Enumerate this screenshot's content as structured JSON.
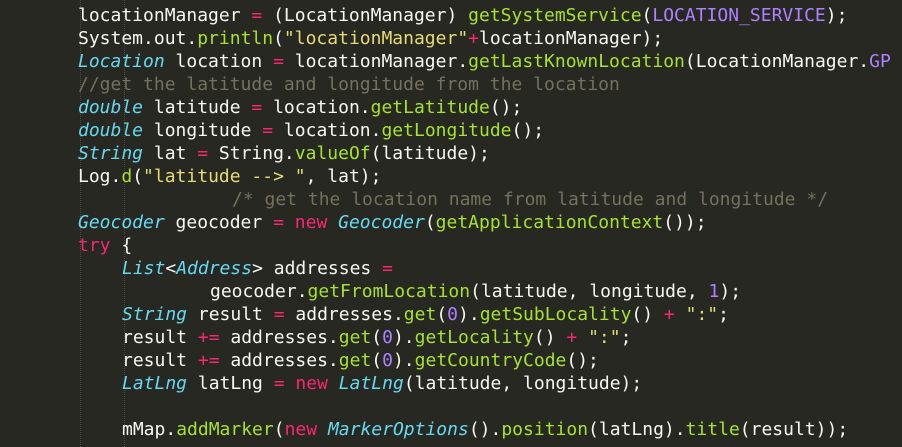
{
  "editor": {
    "language": "java",
    "theme": "monokai",
    "colors": {
      "background": "#272822",
      "plain": "#f8f8f2",
      "method": "#a6e22e",
      "type": "#66d9ef",
      "keyword": "#f92672",
      "string": "#e6db74",
      "number": "#ae81ff",
      "comment": "#75715e"
    },
    "lines": [
      {
        "indent": 1,
        "tokens": [
          {
            "t": "tk",
            "v": "locationManager "
          },
          {
            "t": "op",
            "v": "="
          },
          {
            "t": "tk",
            "v": " (LocationManager) "
          },
          {
            "t": "fn",
            "v": "getSystemService"
          },
          {
            "t": "tk",
            "v": "("
          },
          {
            "t": "cst",
            "v": "LOCATION_SERVICE"
          },
          {
            "t": "tk",
            "v": ");"
          }
        ]
      },
      {
        "indent": 1,
        "tokens": [
          {
            "t": "tk",
            "v": "System.out."
          },
          {
            "t": "fn",
            "v": "println"
          },
          {
            "t": "tk",
            "v": "("
          },
          {
            "t": "str",
            "v": "\"locationManager\""
          },
          {
            "t": "op",
            "v": "+"
          },
          {
            "t": "tk",
            "v": "locationManager);"
          }
        ]
      },
      {
        "indent": 1,
        "tokens": [
          {
            "t": "ty",
            "v": "Location"
          },
          {
            "t": "tk",
            "v": " location "
          },
          {
            "t": "op",
            "v": "="
          },
          {
            "t": "tk",
            "v": " locationManager."
          },
          {
            "t": "fn",
            "v": "getLastKnownLocation"
          },
          {
            "t": "tk",
            "v": "(LocationManager."
          },
          {
            "t": "cst",
            "v": "GP"
          }
        ]
      },
      {
        "indent": 1,
        "tokens": [
          {
            "t": "cm",
            "v": "//get the latitude and longitude from the location"
          }
        ]
      },
      {
        "indent": 1,
        "tokens": [
          {
            "t": "ty",
            "v": "double"
          },
          {
            "t": "tk",
            "v": " latitude "
          },
          {
            "t": "op",
            "v": "="
          },
          {
            "t": "tk",
            "v": " location."
          },
          {
            "t": "fn",
            "v": "getLatitude"
          },
          {
            "t": "tk",
            "v": "();"
          }
        ]
      },
      {
        "indent": 1,
        "tokens": [
          {
            "t": "ty",
            "v": "double"
          },
          {
            "t": "tk",
            "v": " longitude "
          },
          {
            "t": "op",
            "v": "="
          },
          {
            "t": "tk",
            "v": " location."
          },
          {
            "t": "fn",
            "v": "getLongitude"
          },
          {
            "t": "tk",
            "v": "();"
          }
        ]
      },
      {
        "indent": 1,
        "tokens": [
          {
            "t": "ty",
            "v": "String"
          },
          {
            "t": "tk",
            "v": " lat "
          },
          {
            "t": "op",
            "v": "="
          },
          {
            "t": "tk",
            "v": " String."
          },
          {
            "t": "fn",
            "v": "valueOf"
          },
          {
            "t": "tk",
            "v": "(latitude);"
          }
        ]
      },
      {
        "indent": 1,
        "tokens": [
          {
            "t": "tk",
            "v": "Log."
          },
          {
            "t": "fn",
            "v": "d"
          },
          {
            "t": "tk",
            "v": "("
          },
          {
            "t": "str",
            "v": "\"latitude --> \""
          },
          {
            "t": "tk",
            "v": ", lat);"
          }
        ]
      },
      {
        "indent": "c",
        "tokens": [
          {
            "t": "cm",
            "v": "/* get the location name from latitude and longitude */"
          }
        ]
      },
      {
        "indent": 1,
        "tokens": [
          {
            "t": "ty",
            "v": "Geocoder"
          },
          {
            "t": "tk",
            "v": " geocoder "
          },
          {
            "t": "op",
            "v": "="
          },
          {
            "t": "tk",
            "v": " "
          },
          {
            "t": "kw",
            "v": "new"
          },
          {
            "t": "tk",
            "v": " "
          },
          {
            "t": "ty",
            "v": "Geocoder"
          },
          {
            "t": "tk",
            "v": "("
          },
          {
            "t": "fn",
            "v": "getApplicationContext"
          },
          {
            "t": "tk",
            "v": "());"
          }
        ]
      },
      {
        "indent": 1,
        "tokens": [
          {
            "t": "kw",
            "v": "try"
          },
          {
            "t": "tk",
            "v": " {"
          }
        ]
      },
      {
        "indent": 2,
        "tokens": [
          {
            "t": "ty",
            "v": "List"
          },
          {
            "t": "tk",
            "v": "<"
          },
          {
            "t": "ty",
            "v": "Address"
          },
          {
            "t": "tk",
            "v": "> addresses "
          },
          {
            "t": "op",
            "v": "="
          }
        ]
      },
      {
        "indent": 3,
        "tokens": [
          {
            "t": "tk",
            "v": "geocoder."
          },
          {
            "t": "fn",
            "v": "getFromLocation"
          },
          {
            "t": "tk",
            "v": "(latitude, longitude, "
          },
          {
            "t": "num",
            "v": "1"
          },
          {
            "t": "tk",
            "v": ");"
          }
        ]
      },
      {
        "indent": 2,
        "tokens": [
          {
            "t": "ty",
            "v": "String"
          },
          {
            "t": "tk",
            "v": " result "
          },
          {
            "t": "op",
            "v": "="
          },
          {
            "t": "tk",
            "v": " addresses."
          },
          {
            "t": "fn",
            "v": "get"
          },
          {
            "t": "tk",
            "v": "("
          },
          {
            "t": "num",
            "v": "0"
          },
          {
            "t": "tk",
            "v": ")."
          },
          {
            "t": "fn",
            "v": "getSubLocality"
          },
          {
            "t": "tk",
            "v": "() "
          },
          {
            "t": "op",
            "v": "+"
          },
          {
            "t": "tk",
            "v": " "
          },
          {
            "t": "str",
            "v": "\":\""
          },
          {
            "t": "tk",
            "v": ";"
          }
        ]
      },
      {
        "indent": 2,
        "tokens": [
          {
            "t": "tk",
            "v": "result "
          },
          {
            "t": "op",
            "v": "+="
          },
          {
            "t": "tk",
            "v": " addresses."
          },
          {
            "t": "fn",
            "v": "get"
          },
          {
            "t": "tk",
            "v": "("
          },
          {
            "t": "num",
            "v": "0"
          },
          {
            "t": "tk",
            "v": ")."
          },
          {
            "t": "fn",
            "v": "getLocality"
          },
          {
            "t": "tk",
            "v": "() "
          },
          {
            "t": "op",
            "v": "+"
          },
          {
            "t": "tk",
            "v": " "
          },
          {
            "t": "str",
            "v": "\":\""
          },
          {
            "t": "tk",
            "v": ";"
          }
        ]
      },
      {
        "indent": 2,
        "tokens": [
          {
            "t": "tk",
            "v": "result "
          },
          {
            "t": "op",
            "v": "+="
          },
          {
            "t": "tk",
            "v": " addresses."
          },
          {
            "t": "fn",
            "v": "get"
          },
          {
            "t": "tk",
            "v": "("
          },
          {
            "t": "num",
            "v": "0"
          },
          {
            "t": "tk",
            "v": ")."
          },
          {
            "t": "fn",
            "v": "getCountryCode"
          },
          {
            "t": "tk",
            "v": "();"
          }
        ]
      },
      {
        "indent": 2,
        "tokens": [
          {
            "t": "ty",
            "v": "LatLng"
          },
          {
            "t": "tk",
            "v": " latLng "
          },
          {
            "t": "op",
            "v": "="
          },
          {
            "t": "tk",
            "v": " "
          },
          {
            "t": "kw",
            "v": "new"
          },
          {
            "t": "tk",
            "v": " "
          },
          {
            "t": "ty",
            "v": "LatLng"
          },
          {
            "t": "tk",
            "v": "(latitude, longitude);"
          }
        ]
      },
      {
        "indent": 2,
        "tokens": []
      },
      {
        "indent": 2,
        "tokens": [
          {
            "t": "tk",
            "v": "mMap."
          },
          {
            "t": "fn",
            "v": "addMarker"
          },
          {
            "t": "tk",
            "v": "("
          },
          {
            "t": "kw",
            "v": "new"
          },
          {
            "t": "tk",
            "v": " "
          },
          {
            "t": "ty",
            "v": "MarkerOptions"
          },
          {
            "t": "tk",
            "v": "()."
          },
          {
            "t": "fn",
            "v": "position"
          },
          {
            "t": "tk",
            "v": "(latLng)."
          },
          {
            "t": "fn",
            "v": "title"
          },
          {
            "t": "tk",
            "v": "(result));"
          }
        ]
      }
    ]
  }
}
